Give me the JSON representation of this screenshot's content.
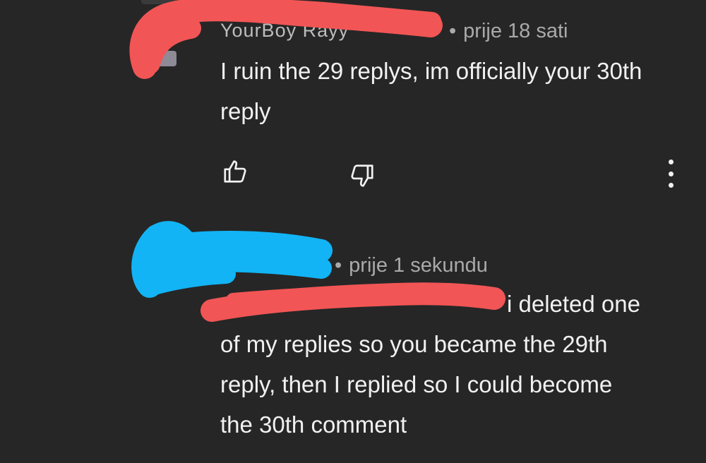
{
  "comments": [
    {
      "author": "YourBoy Rayy",
      "timestamp": "prije 18 sati",
      "text": "I ruin the 29 replys, im officially your 30th reply",
      "actions": {
        "like_icon": "thumbs-up-icon",
        "dislike_icon": "thumbs-down-icon",
        "menu_icon": "more-vertical-icon"
      }
    },
    {
      "timestamp": "prije 1 sekundu",
      "text_line1": "i deleted one",
      "text_rest": "of my replies so you became the 29th reply, then I replied so I could become the 30th comment"
    }
  ],
  "separator": "•",
  "colors": {
    "background": "#262626",
    "text": "#f1f1f1",
    "meta": "#aaaaaa",
    "redact_red": "#f25555",
    "redact_blue": "#12b4f5"
  }
}
